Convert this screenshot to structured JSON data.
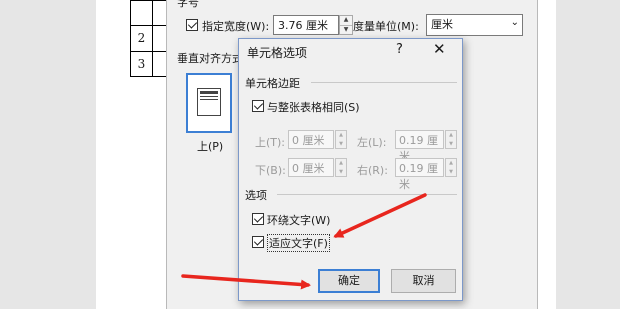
{
  "document": {
    "rows": [
      "2",
      "3"
    ]
  },
  "table_properties": {
    "heading_partial": "字号",
    "preferred_width_label": "指定宽度(W):",
    "preferred_width_value": "3.76 厘米",
    "measure_in_label": "度量单位(M):",
    "measure_in_value": "厘米",
    "vertical_alignment_label": "垂直对齐方式",
    "align_top_label": "上(P)"
  },
  "cell_options": {
    "title": "单元格选项",
    "help": "?",
    "close": "✕",
    "margins_group": "单元格边距",
    "same_as_table_label": "与整张表格相同(S)",
    "top_label": "上(T):",
    "top_value": "0 厘米",
    "left_label": "左(L):",
    "left_value": "0.19 厘米",
    "bottom_label": "下(B):",
    "bottom_value": "0 厘米",
    "right_label": "右(R):",
    "right_value": "0.19 厘米",
    "options_group": "选项",
    "wrap_text_label": "环绕文字(W)",
    "fit_text_label": "适应文字(F)",
    "ok_label": "确定",
    "cancel_label": "取消"
  },
  "colors": {
    "arrow": "#e8261e",
    "accent": "#3c7fd4"
  }
}
